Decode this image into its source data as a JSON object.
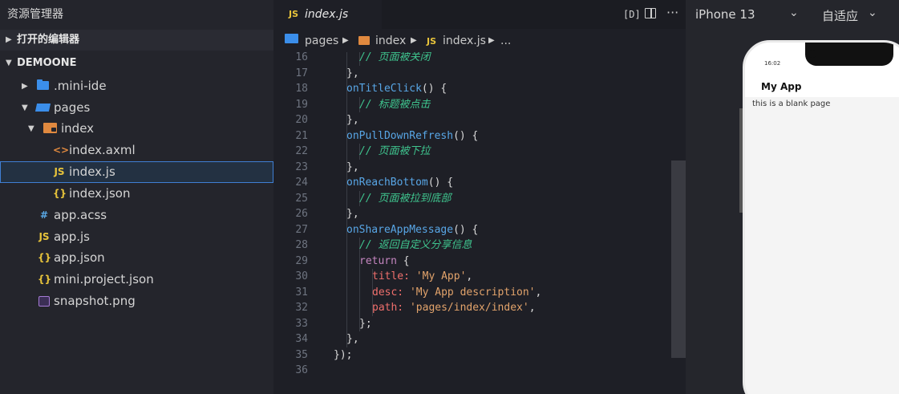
{
  "sidebar": {
    "title": "资源管理器",
    "open_editors": "打开的编辑器",
    "project": "DEMOONE",
    "items": [
      {
        "label": ".mini-ide",
        "icon": "folder-icon"
      },
      {
        "label": "pages",
        "icon": "folder-open-icon"
      },
      {
        "label": "index",
        "icon": "component-folder-icon"
      },
      {
        "label": "index.axml",
        "icon": "<>"
      },
      {
        "label": "index.js",
        "icon": "JS"
      },
      {
        "label": "index.json",
        "icon": "{}"
      },
      {
        "label": "app.acss",
        "icon": "#"
      },
      {
        "label": "app.js",
        "icon": "JS"
      },
      {
        "label": "app.json",
        "icon": "{}"
      },
      {
        "label": "mini.project.json",
        "icon": "{}"
      },
      {
        "label": "snapshot.png",
        "icon": "image-icon"
      }
    ]
  },
  "editor": {
    "tab": {
      "badge": "JS",
      "label": "index.js"
    },
    "breadcrumb": [
      "pages",
      "index",
      "index.js",
      "..."
    ],
    "breadcrumb_js_badge": "JS",
    "lines": [
      {
        "n": "16",
        "parts": [
          [
            "c-cmt",
            "// 页面被关闭"
          ]
        ],
        "indent": 1
      },
      {
        "n": "17",
        "parts": [
          [
            "c-plain",
            "},"
          ]
        ],
        "indent": 0
      },
      {
        "n": "18",
        "parts": [
          [
            "c-fn",
            "onTitleClick"
          ],
          [
            "c-plain",
            "() {"
          ]
        ],
        "indent": 0
      },
      {
        "n": "19",
        "parts": [
          [
            "c-cmt",
            "// 标题被点击"
          ]
        ],
        "indent": 1
      },
      {
        "n": "20",
        "parts": [
          [
            "c-plain",
            "},"
          ]
        ],
        "indent": 0
      },
      {
        "n": "21",
        "parts": [
          [
            "c-fn",
            "onPullDownRefresh"
          ],
          [
            "c-plain",
            "() {"
          ]
        ],
        "indent": 0
      },
      {
        "n": "22",
        "parts": [
          [
            "c-cmt",
            "// 页面被下拉"
          ]
        ],
        "indent": 1
      },
      {
        "n": "23",
        "parts": [
          [
            "c-plain",
            "},"
          ]
        ],
        "indent": 0
      },
      {
        "n": "24",
        "parts": [
          [
            "c-fn",
            "onReachBottom"
          ],
          [
            "c-plain",
            "() {"
          ]
        ],
        "indent": 0
      },
      {
        "n": "25",
        "parts": [
          [
            "c-cmt",
            "// 页面被拉到底部"
          ]
        ],
        "indent": 1
      },
      {
        "n": "26",
        "parts": [
          [
            "c-plain",
            "},"
          ]
        ],
        "indent": 0
      },
      {
        "n": "27",
        "parts": [
          [
            "c-fn",
            "onShareAppMessage"
          ],
          [
            "c-plain",
            "() {"
          ]
        ],
        "indent": 0
      },
      {
        "n": "28",
        "parts": [
          [
            "c-cmt",
            "// 返回自定义分享信息"
          ]
        ],
        "indent": 1
      },
      {
        "n": "29",
        "parts": [
          [
            "c-kw",
            "return"
          ],
          [
            "c-plain",
            " {"
          ]
        ],
        "indent": 1
      },
      {
        "n": "30",
        "parts": [
          [
            "c-prop",
            "title:"
          ],
          [
            "c-plain",
            " "
          ],
          [
            "c-str",
            "'My App'"
          ],
          [
            "c-plain",
            ","
          ]
        ],
        "indent": 2
      },
      {
        "n": "31",
        "parts": [
          [
            "c-prop",
            "desc:"
          ],
          [
            "c-plain",
            " "
          ],
          [
            "c-str",
            "'My App description'"
          ],
          [
            "c-plain",
            ","
          ]
        ],
        "indent": 2
      },
      {
        "n": "32",
        "parts": [
          [
            "c-prop",
            "path:"
          ],
          [
            "c-plain",
            " "
          ],
          [
            "c-str",
            "'pages/index/index'"
          ],
          [
            "c-plain",
            ","
          ]
        ],
        "indent": 2
      },
      {
        "n": "33",
        "parts": [
          [
            "c-plain",
            "};"
          ]
        ],
        "indent": 1
      },
      {
        "n": "34",
        "parts": [
          [
            "c-plain",
            "},"
          ]
        ],
        "indent": 0
      },
      {
        "n": "35",
        "parts": [
          [
            "c-plain",
            "});"
          ]
        ],
        "indent": -1
      },
      {
        "n": "36",
        "parts": [],
        "indent": -1
      }
    ]
  },
  "toolbar": {
    "device": "iPhone 13",
    "scale": "自适应"
  },
  "simulator": {
    "time": "16:02",
    "nav_title": "My App",
    "body_text": "this is a blank page"
  }
}
